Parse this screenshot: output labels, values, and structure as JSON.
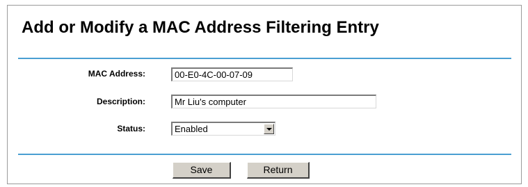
{
  "page": {
    "title": "Add or Modify a MAC Address Filtering Entry"
  },
  "form": {
    "mac_address": {
      "label": "MAC Address:",
      "value": "00-E0-4C-00-07-09"
    },
    "description": {
      "label": "Description:",
      "value": "Mr Liu's computer"
    },
    "status": {
      "label": "Status:",
      "selected": "Enabled"
    }
  },
  "buttons": {
    "save_label": "Save",
    "return_label": "Return"
  },
  "colors": {
    "divider": "#4a9fd2",
    "button_face": "#d4d0c8"
  }
}
